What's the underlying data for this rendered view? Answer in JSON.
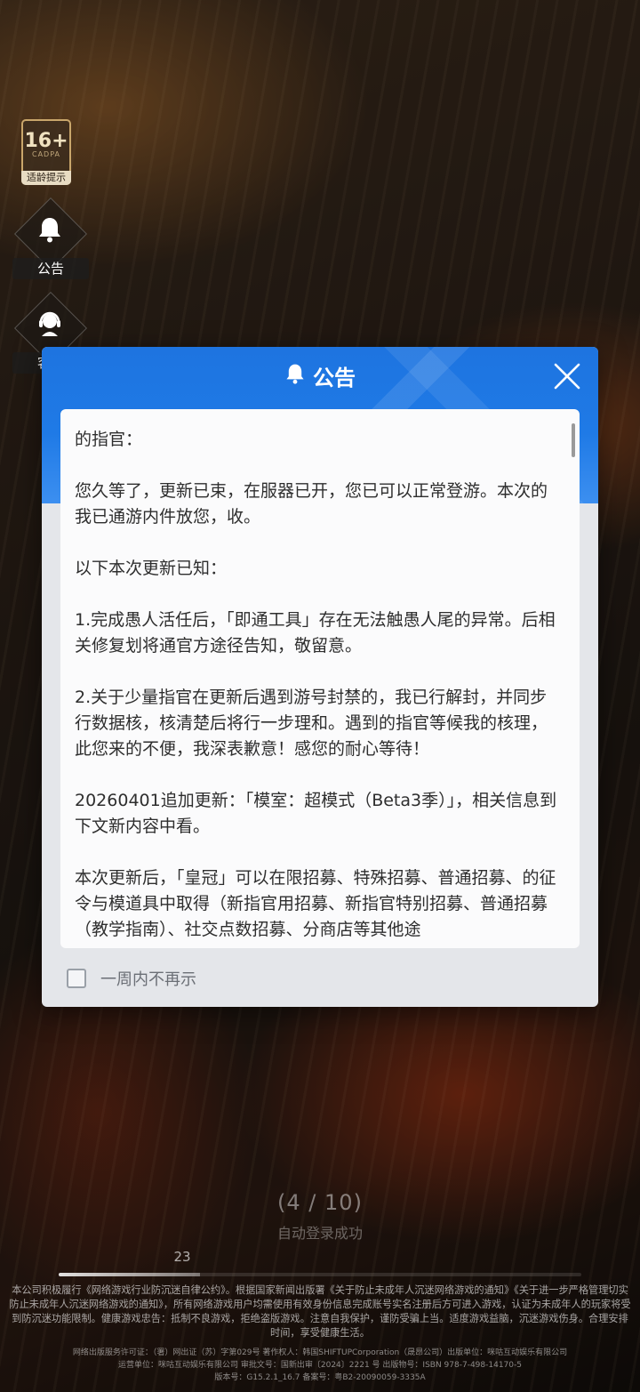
{
  "age_badge": {
    "number": "16+",
    "org": "CADPA",
    "tip": "适龄提示"
  },
  "side": {
    "notice_label": "公告",
    "support_label": "客服"
  },
  "modal": {
    "title": "公告",
    "paragraphs": [
      "的指官：",
      "您久等了，更新已束，在服器已开，您已可以正常登游。本次的我已通游内件放您，收。",
      "以下本次更新已知：",
      "1.完成愚人活任后，「即通工具」存在无法触愚人尾的异常。后相关修复划将通官方途径告知，敬留意。",
      "2.关于少量指官在更新后遇到游号封禁的，我已行解封，并同步行数据核，核清楚后将行一步理和。遇到的指官等候我的核理，此您来的不便，我深表歉意！感您的耐心等待！",
      "20260401追加更新：「模室：超模式（Beta3季）」，相关信息到下文新内容中看。",
      "本次更新后，「皇冠」可以在限招募、特殊招募、普通招募、的征令与模道具中取得（新指官用招募、新指官特别招募、普通招募（教学指南）、社交点数招募、分商店等其他途"
    ],
    "checkbox_label": "一周内不再示",
    "checkbox_checked": false
  },
  "loading": {
    "count": "(4 / 10)",
    "status": "自动登录成功",
    "small_number": "23",
    "progress": 0.27
  },
  "footer": {
    "main": "本公司积极履行《网络游戏行业防沉迷自律公约》。根据国家新闻出版署《关于防止未成年人沉迷网络游戏的通知》《关于进一步严格管理切实防止未成年人沉迷网络游戏的通知》，所有网络游戏用户均需使用有效身份信息完成账号实名注册后方可进入游戏，认证为未成年人的玩家将受到防沉迷功能限制。健康游戏忠告：抵制不良游戏，拒绝盗版游戏。注意自我保护，谨防受骗上当。适度游戏益脑，沉迷游戏伤身。合理安排时间，享受健康生活。",
    "line1": "网络出版服务许可证：（署）网出证（苏）字第029号 著作权人：韩国SHIFTUPCorporation（晟昂公司）出版单位：咪咕互动娱乐有限公司",
    "line2": "运营单位：咪咕互动娱乐有限公司 审批文号：国新出审〔2024〕2221 号 出版物号：ISBN 978-7-498-14170-5",
    "line3": "版本号：G15.2.1_16.7   备案号：粤B2-20090059-3335A"
  },
  "colors": {
    "header_blue": "#1f7ae6",
    "card_bg": "#fbfbfc",
    "modal_bg": "#e4e6ea"
  }
}
